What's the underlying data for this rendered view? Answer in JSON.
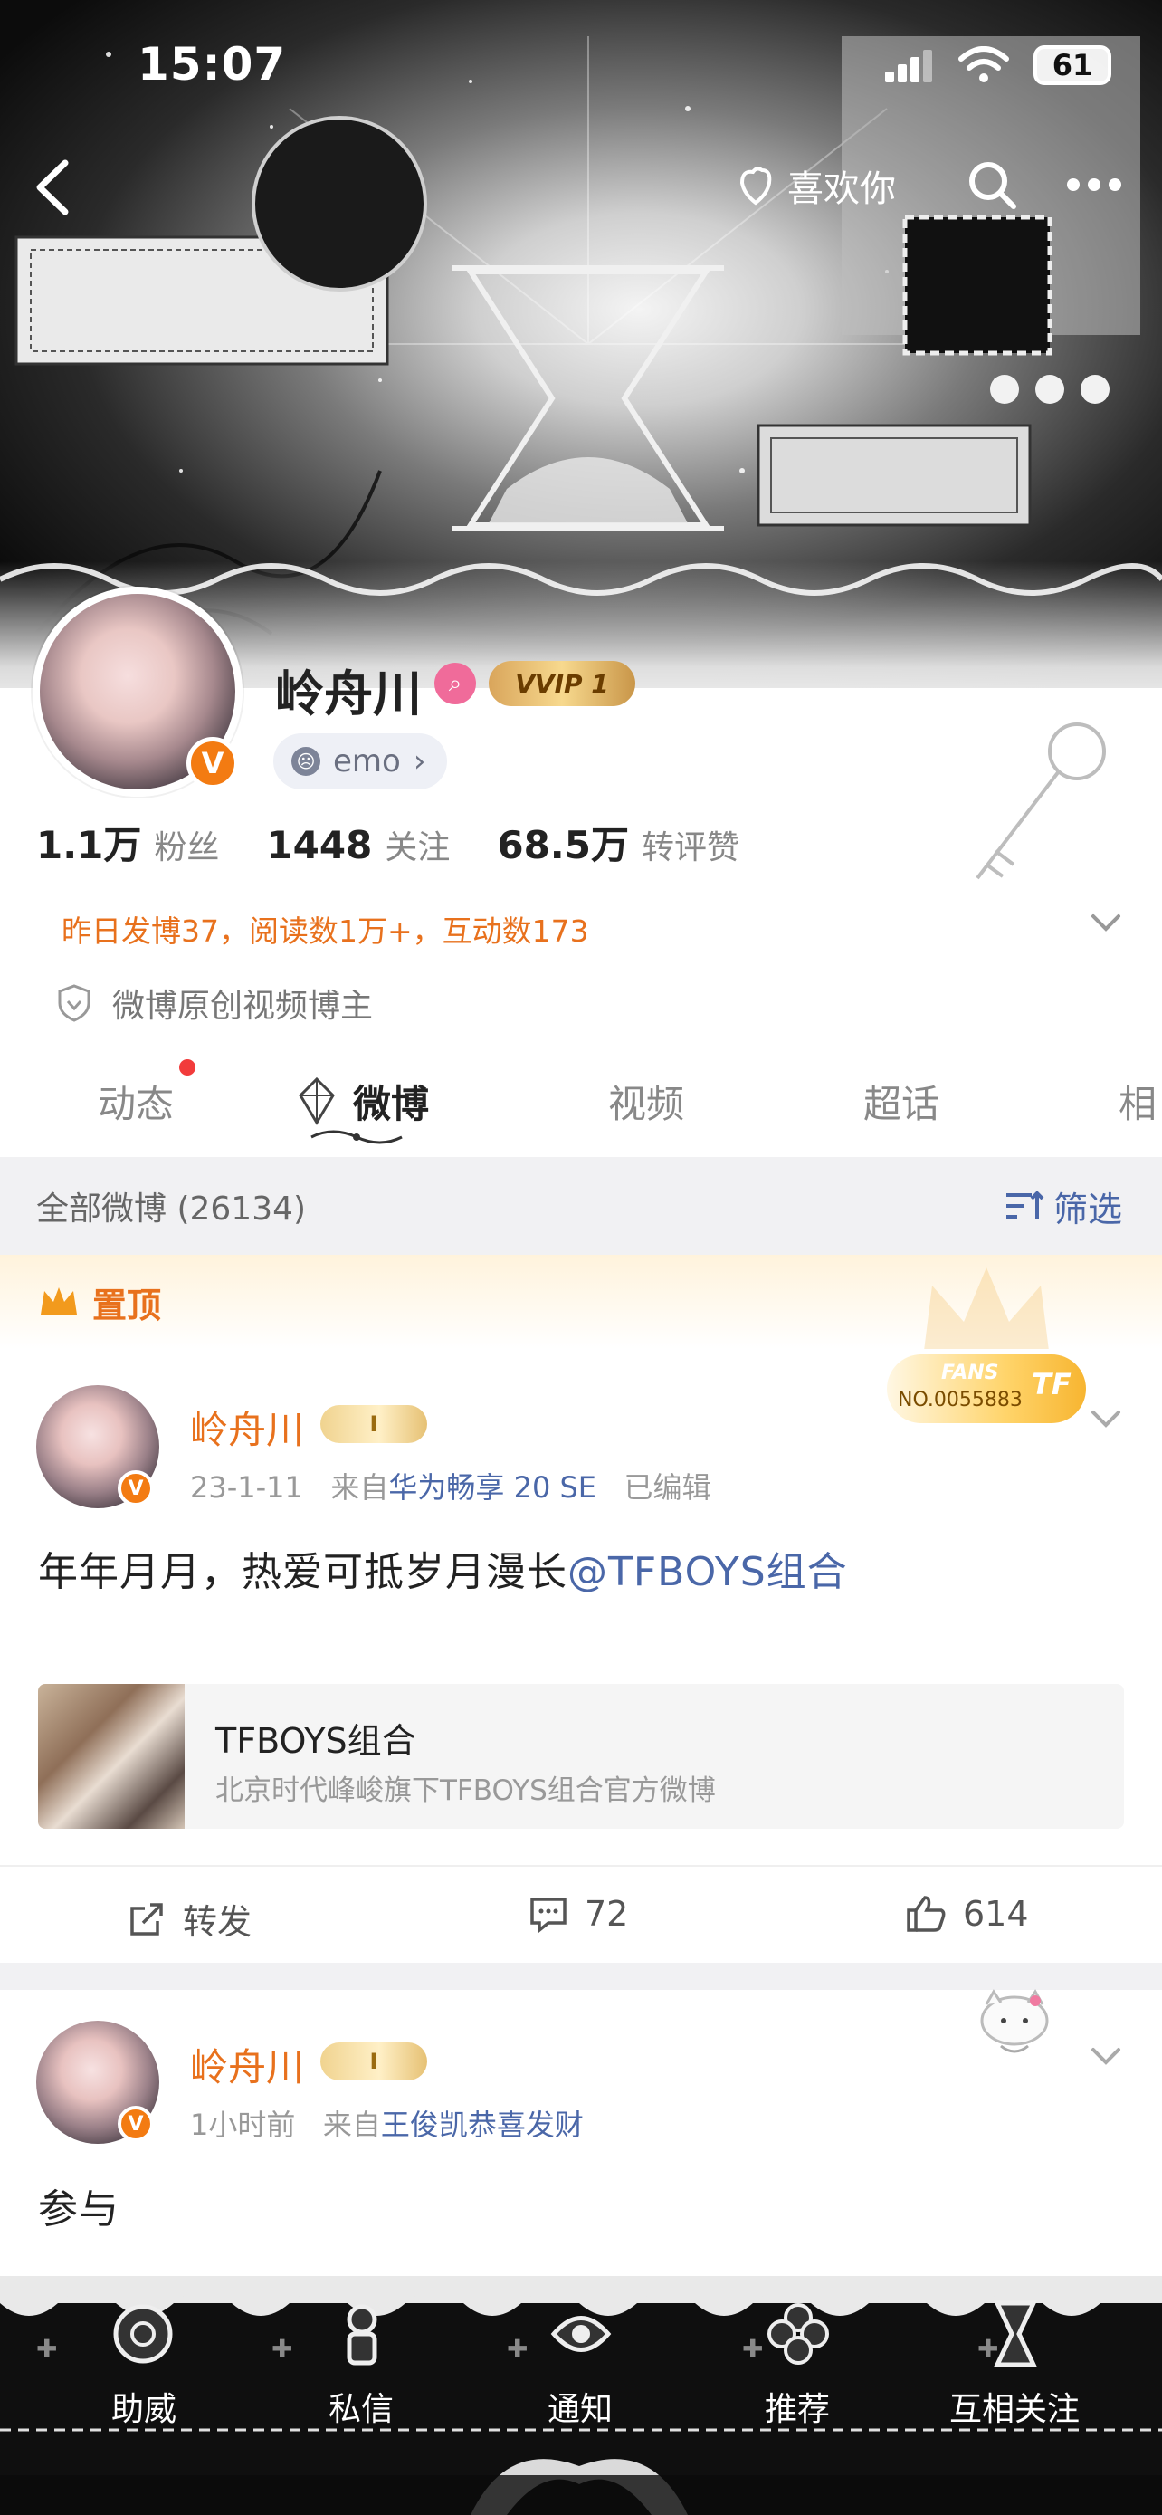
{
  "status_bar": {
    "time": "15:07",
    "battery": "61"
  },
  "nav": {
    "like_label": "喜欢你",
    "back_icon": "chevron-left-icon",
    "search_icon": "search-icon",
    "more_icon": "more-icon"
  },
  "profile": {
    "name": "岭舟川",
    "vip_label": "VVIP 1",
    "verified_mark": "V",
    "mood": "emo",
    "stats": [
      {
        "value": "1.1万",
        "label": "粉丝"
      },
      {
        "value": "1448",
        "label": "关注"
      },
      {
        "value": "68.5万",
        "label": "转评赞"
      }
    ],
    "daily_summary": "昨日发博37，阅读数1万+，互动数173",
    "verification": "微博原创视频博主"
  },
  "tabs": [
    {
      "label": "动态",
      "active": false,
      "has_dot": true
    },
    {
      "label": "微博",
      "active": true,
      "has_dot": false
    },
    {
      "label": "视频",
      "active": false,
      "has_dot": false
    },
    {
      "label": "超话",
      "active": false,
      "has_dot": false
    },
    {
      "label": "相",
      "active": false,
      "has_dot": false
    }
  ],
  "section": {
    "title": "全部微博 (26134)",
    "filter_label": "筛选"
  },
  "pinned": {
    "label": "置顶",
    "fans_badge": {
      "top": "FANS",
      "number": "NO.0055883",
      "logo": "TF"
    }
  },
  "posts": [
    {
      "author": "岭舟川",
      "level": "I",
      "time": "23-1-11",
      "source_prefix": "来自",
      "device": "华为畅享 20 SE",
      "edited": "已编辑",
      "text": "年年月月，热爱可抵岁月漫长",
      "mention": "@TFBOYS组合",
      "link_card": {
        "title": "TFBOYS组合",
        "description": "北京时代峰峻旗下TFBOYS组合官方微博"
      },
      "actions": {
        "repost": "转发",
        "comments": "72",
        "likes": "614"
      }
    },
    {
      "author": "岭舟川",
      "level": "I",
      "time": "1小时前",
      "source_prefix": "来自",
      "device": "王俊凯恭喜发财",
      "text": "参与"
    }
  ],
  "bottom_bar": {
    "items": [
      "助威",
      "私信",
      "通知",
      "推荐",
      "互相关注"
    ]
  },
  "colors": {
    "accent_orange": "#e8711d",
    "link_blue": "#4a67a8",
    "badge_orange": "#f37b12",
    "notification_red": "#f23b3b"
  }
}
